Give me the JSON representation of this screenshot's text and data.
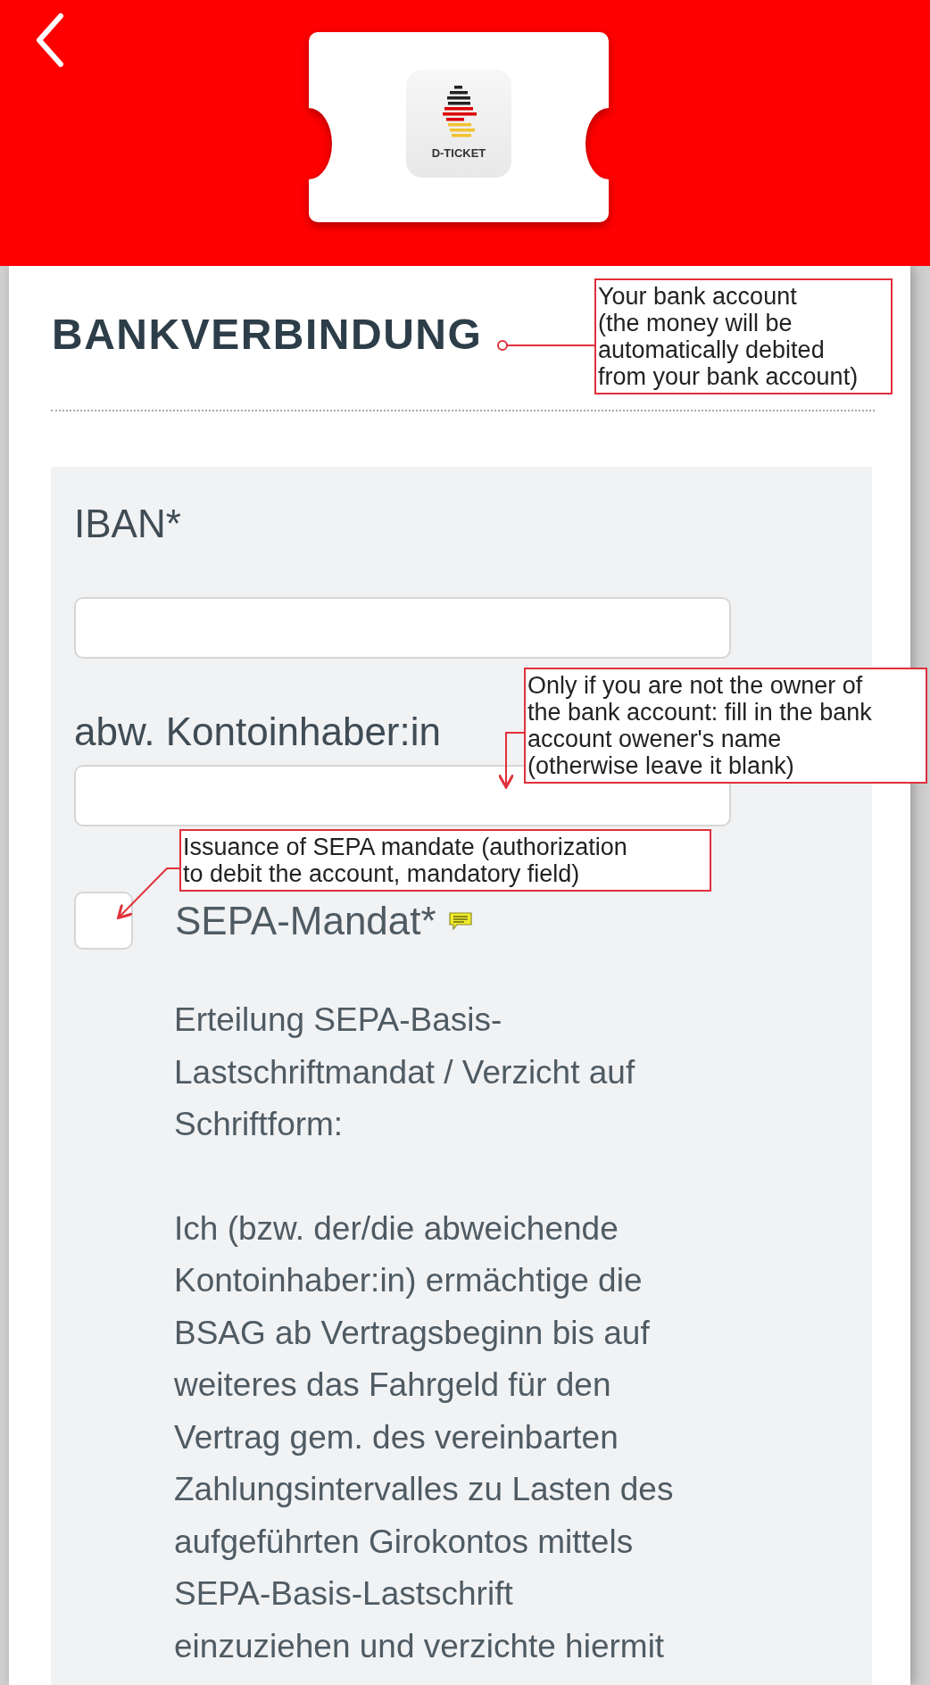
{
  "header": {
    "logo_text": "D-TICKET"
  },
  "section_title": "BANKVERBINDUNG",
  "fields": [
    {
      "label": "IBAN*"
    },
    {
      "label": "abw. Kontoinhaber:in"
    }
  ],
  "mandate": {
    "label": "SEPA-Mandat*",
    "checked": false,
    "paragraphs": [
      "Erteilung SEPA-Basis-\nLastschriftmandat / Verzicht auf\nSchriftform:",
      "Ich (bzw. der/die abweichende\nKontoinhaber:in) ermächtige die\nBSAG ab Vertragsbeginn bis auf\nweiteres das Fahrgeld für den\nVertrag gem. des vereinbarten\nZahlungsintervalles zu Lasten des\naufgeführten Girokontos mittels\nSEPA-Basis-Lastschrift\neinzuziehen und verzichte hiermit"
    ]
  },
  "annotations": [
    {
      "text": "Your bank account\n(the money will be\nautomatically debited\nfrom your bank account)"
    },
    {
      "text": "Only if you are not the owner of\nthe bank account: fill in the bank\naccount owener's name\n(otherwise leave it blank)"
    },
    {
      "text": "Issuance of SEPA mandate (authorization\nto debit the account, mandatory field)"
    }
  ]
}
